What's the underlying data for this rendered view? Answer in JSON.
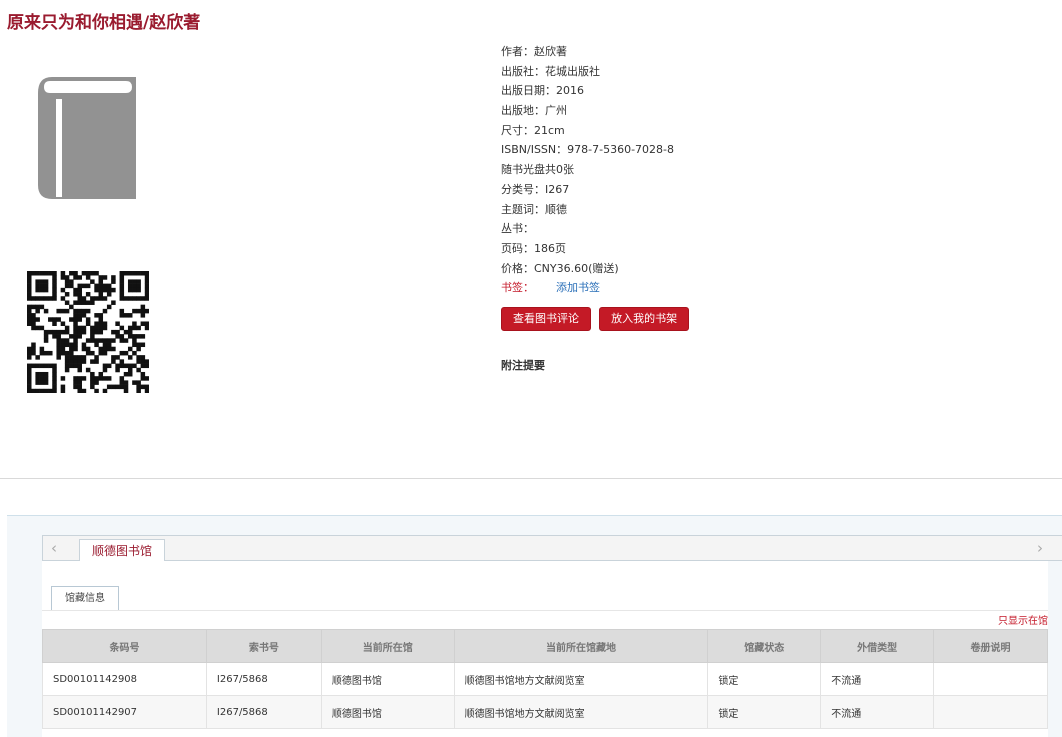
{
  "book": {
    "title": "原来只为和你相遇/赵欣著",
    "info": [
      {
        "label": "作者：",
        "value": "赵欣著"
      },
      {
        "label": "出版社：",
        "value": "花城出版社"
      },
      {
        "label": "出版日期：",
        "value": "2016"
      },
      {
        "label": "出版地：",
        "value": "广州"
      },
      {
        "label": "尺寸：",
        "value": "21cm"
      },
      {
        "label": "ISBN/ISSN：",
        "value": "978-7-5360-7028-8"
      },
      {
        "label": "随书光盘共0张",
        "value": ""
      },
      {
        "label": "分类号：",
        "value": "I267"
      },
      {
        "label": "主题词：",
        "value": "顺德"
      },
      {
        "label": "丛书：",
        "value": ""
      },
      {
        "label": "页码：",
        "value": "186页"
      },
      {
        "label": "价格：",
        "value": "CNY36.60(赠送)"
      }
    ],
    "bookmark_label": "书签：",
    "add_bookmark": "添加书签",
    "view_reviews_button": "查看图书评论",
    "add_to_shelf_button": "放入我的书架",
    "notes_heading": "附注提要"
  },
  "holdings": {
    "library_tab": "顺德图书馆",
    "subtab": "馆藏信息",
    "only_show_link": "只显示在馆",
    "columns": [
      "条码号",
      "索书号",
      "当前所在馆",
      "当前所在馆藏地",
      "馆藏状态",
      "外借类型",
      "卷册说明"
    ],
    "rows": [
      [
        "SD00101142908",
        "I267/5868",
        "顺德图书馆",
        "顺德图书馆地方文献阅览室",
        "锁定",
        "不流通",
        ""
      ],
      [
        "SD00101142907",
        "I267/5868",
        "顺德图书馆",
        "顺德图书馆地方文献阅览室",
        "锁定",
        "不流通",
        ""
      ]
    ]
  },
  "icons": {
    "cover": "book-icon",
    "scroll_left": "chevron-left-icon",
    "scroll_right": "chevron-right-icon"
  },
  "colors": {
    "title": "#9a1b2f",
    "button": "#c41a26",
    "link": "#2a6fb8",
    "book_cover": "#929292"
  }
}
